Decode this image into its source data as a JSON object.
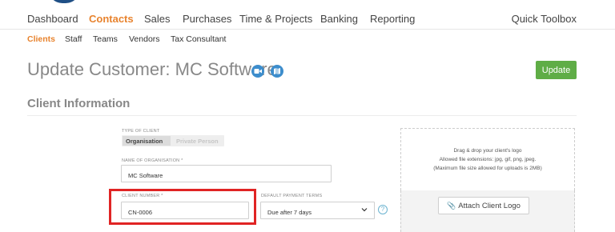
{
  "main_nav": [
    {
      "label": "Dashboard",
      "active": false
    },
    {
      "label": "Contacts",
      "active": true
    },
    {
      "label": "Sales",
      "active": false
    },
    {
      "label": "Purchases",
      "active": false
    },
    {
      "label": "Time & Projects",
      "active": false
    },
    {
      "label": "Banking",
      "active": false
    },
    {
      "label": "Reporting",
      "active": false
    }
  ],
  "quick_toolbox": "Quick Toolbox",
  "sub_nav": [
    {
      "label": "Clients",
      "active": true
    },
    {
      "label": "Staff",
      "active": false
    },
    {
      "label": "Teams",
      "active": false
    },
    {
      "label": "Vendors",
      "active": false
    },
    {
      "label": "Tax Consultant",
      "active": false
    }
  ],
  "page": {
    "title": "Update Customer: MC Software",
    "update_button": "Update",
    "icons": [
      "video-icon",
      "map-icon"
    ]
  },
  "section": {
    "title": "Client Information"
  },
  "form": {
    "type_of_client_label": "TYPE OF CLIENT",
    "type_options": [
      "Organisation",
      "Private Person"
    ],
    "type_selected": "Organisation",
    "org_name_label": "NAME OF ORGANISATION *",
    "org_name_value": "MC Software",
    "client_number_label": "CLIENT NUMBER *",
    "client_number_value": "CN-0006",
    "payment_terms_label": "DEFAULT PAYMENT TERMS",
    "payment_terms_value": "Due after 7 days",
    "help_glyph": "?"
  },
  "logo_upload": {
    "line1": "Drag & drop your client's logo",
    "line2": "Allowed file extensions: jpg, gif, png, jpeg.",
    "line3": "(Maximum file size allowed for uploads is 2MB)",
    "button": "Attach Client Logo",
    "button_icon": "paperclip-icon"
  },
  "colors": {
    "accent_orange": "#e8832e",
    "update_green": "#5fad46",
    "icon_blue": "#3d8dcc",
    "highlight_red": "#e02424"
  }
}
